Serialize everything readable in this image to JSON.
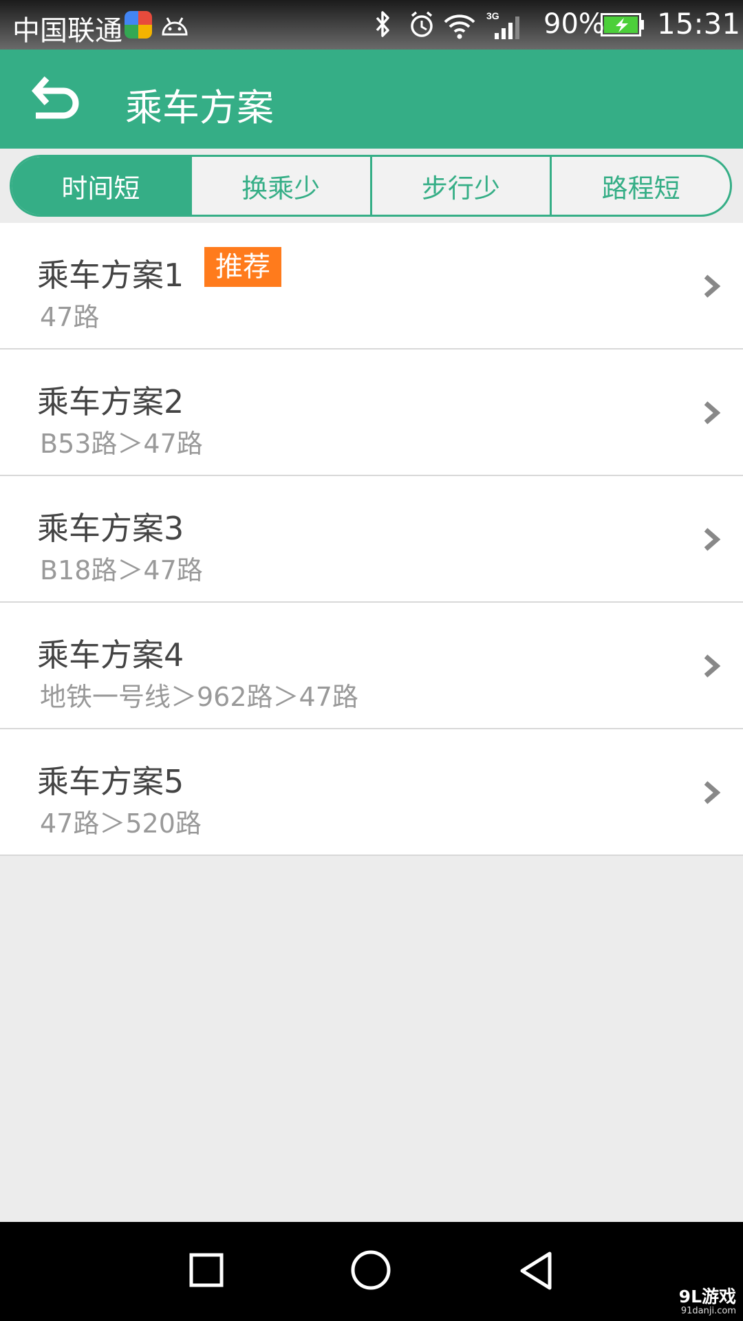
{
  "status_bar": {
    "carrier": "中国联通",
    "network": "3G",
    "battery_percent": "90%",
    "time": "15:31",
    "icons": [
      "app-store-icon",
      "android-icon",
      "bluetooth-icon",
      "alarm-icon",
      "wifi-icon",
      "signal-icon",
      "battery-charging-icon"
    ]
  },
  "app_bar": {
    "title": "乘车方案",
    "back_icon": "back-arrow-icon"
  },
  "tabs": [
    {
      "label": "时间短",
      "active": true
    },
    {
      "label": "换乘少",
      "active": false
    },
    {
      "label": "步行少",
      "active": false
    },
    {
      "label": "路程短",
      "active": false
    }
  ],
  "plans": [
    {
      "title": "乘车方案1",
      "badge": "推荐",
      "route": "47路"
    },
    {
      "title": "乘车方案2",
      "badge": "",
      "route": "B53路＞47路"
    },
    {
      "title": "乘车方案3",
      "badge": "",
      "route": "B18路＞47路"
    },
    {
      "title": "乘车方案4",
      "badge": "",
      "route": "地铁一号线＞962路＞47路"
    },
    {
      "title": "乘车方案5",
      "badge": "",
      "route": "47路＞520路"
    }
  ],
  "nav_bar": {
    "icons": [
      "recent-apps-icon",
      "home-icon",
      "back-icon"
    ]
  },
  "watermark": {
    "logo": "9L游戏",
    "url": "91danji.com"
  },
  "colors": {
    "primary": "#35ae86",
    "badge": "#ff7b1c",
    "background": "#ececec"
  }
}
